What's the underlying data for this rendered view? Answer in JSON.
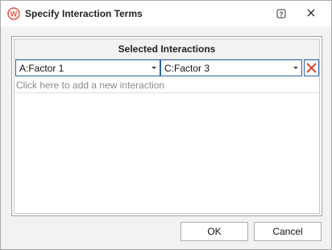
{
  "window": {
    "title": "Specify Interaction Terms",
    "icon": "app-logo-icon",
    "help_icon": "help-icon",
    "close_icon": "close-icon"
  },
  "panel": {
    "header": "Selected Interactions",
    "interactions": [
      {
        "first": "A:Factor 1",
        "second": "C:Factor 3"
      }
    ],
    "add_hint": "Click here to add a new interaction",
    "delete_icon": "delete-x-icon"
  },
  "buttons": {
    "ok": "OK",
    "cancel": "Cancel"
  },
  "colors": {
    "accent": "#2b63a5",
    "logo": "#e0533c",
    "delete": "#d9412b"
  }
}
